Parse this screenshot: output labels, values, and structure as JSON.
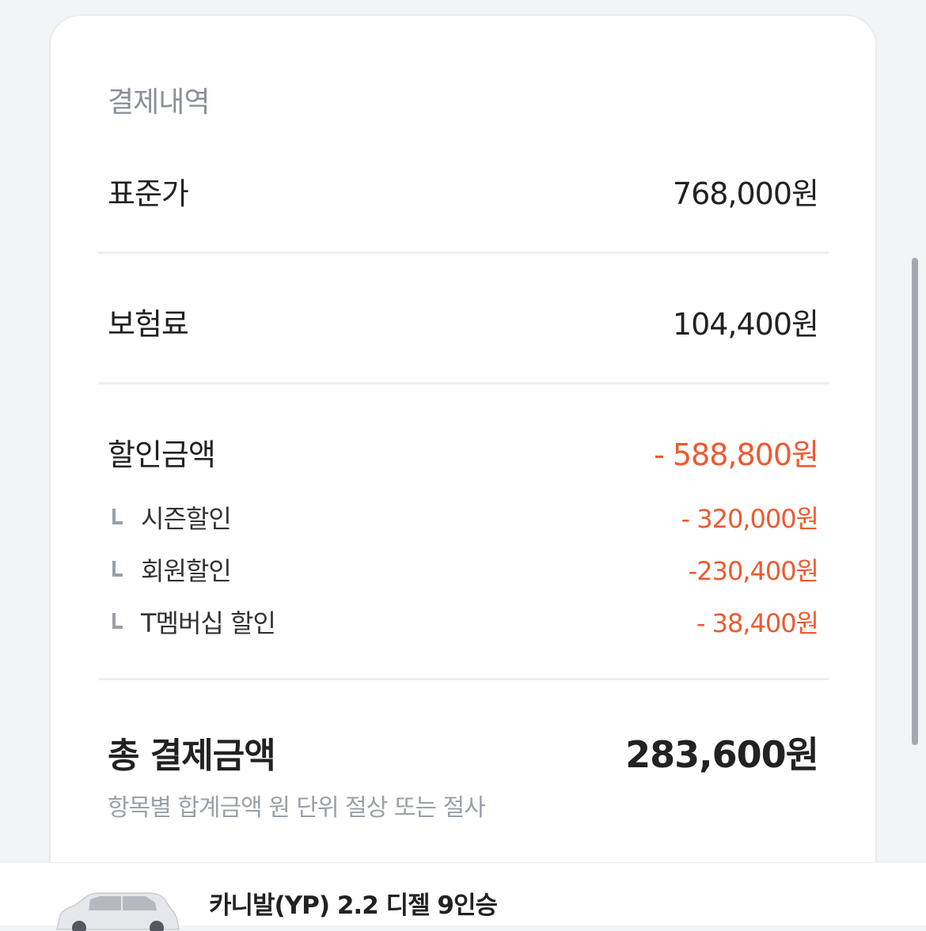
{
  "payment": {
    "title": "결제내역",
    "standard_price": {
      "label": "표준가",
      "value": "768,000원"
    },
    "insurance": {
      "label": "보험료",
      "value": "104,400원"
    },
    "discount": {
      "label": "할인금액",
      "value": "- 588,800원",
      "items": [
        {
          "label": "시즌할인",
          "value": "- 320,000원"
        },
        {
          "label": "회원할인",
          "value": "-230,400원"
        },
        {
          "label": "T멤버십 할인",
          "value": "- 38,400원"
        }
      ]
    },
    "total": {
      "label": "총 결제금액",
      "value": "283,600원"
    },
    "note": "항목별 합계금액 원 단위 절상 또는 절사"
  },
  "car": {
    "name": "카니발(YP) 2.2 디젤 9인승"
  },
  "colors": {
    "discount_red": "#ee5a2f",
    "text_dark": "#222222",
    "text_gray": "#9aa0a8"
  }
}
